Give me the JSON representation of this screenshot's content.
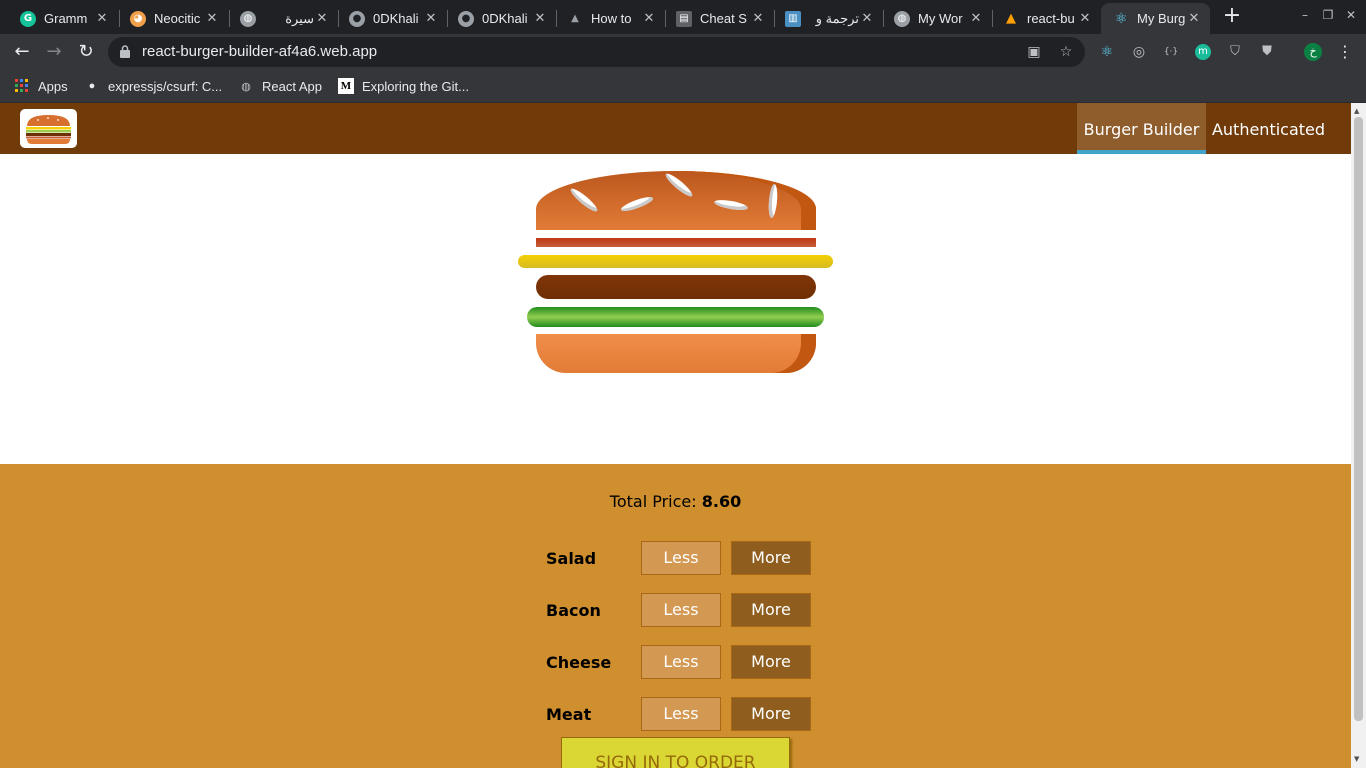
{
  "browser": {
    "tabs": [
      {
        "title": "Gramm",
        "icon": "grammarly-icon",
        "color": "#15c39a",
        "glyph": "G"
      },
      {
        "title": "Neocitic",
        "icon": "neocities-cat-icon",
        "color": "#f0a04b",
        "glyph": "🐱"
      },
      {
        "title": "سيرة",
        "icon": "globe-icon",
        "color": "#9aa0a6",
        "glyph": "◍"
      },
      {
        "title": "0DKhali",
        "icon": "github-icon",
        "color": "#9aa0a6",
        "glyph": "●"
      },
      {
        "title": "0DKhali",
        "icon": "github-icon",
        "color": "#9aa0a6",
        "glyph": "●"
      },
      {
        "title": "How to",
        "icon": "triangle-logo-icon",
        "color": "#9aa0a6",
        "glyph": "▲"
      },
      {
        "title": "Cheat S",
        "icon": "cheatsheet-icon",
        "color": "#5f6368",
        "glyph": "▤"
      },
      {
        "title": "ترجمة و",
        "icon": "book-icon",
        "color": "#4a90c2",
        "glyph": "▥"
      },
      {
        "title": "My Wor",
        "icon": "globe-icon",
        "color": "#9aa0a6",
        "glyph": "◍"
      },
      {
        "title": "react-bu",
        "icon": "firebase-icon",
        "color": "#ffa000",
        "glyph": "▲"
      },
      {
        "title": "My Burg",
        "icon": "react-icon",
        "color": "#61dafb",
        "glyph": "⚛"
      }
    ],
    "active_tab_index": 10,
    "url": "react-burger-builder-af4a6.web.app",
    "bookmarks": [
      {
        "label": "Apps",
        "icon": "apps-grid-icon"
      },
      {
        "label": "expressjs/csurf: C...",
        "icon": "github-icon"
      },
      {
        "label": "React App",
        "icon": "globe-icon"
      },
      {
        "label": "Exploring the Git...",
        "icon": "medium-icon"
      }
    ],
    "profile_initial": "خ"
  },
  "app": {
    "nav": {
      "burger_builder": "Burger Builder",
      "authenticated": "Authenticated"
    },
    "total_price_label": "Total Price:",
    "total_price_value": "8.60",
    "controls": [
      {
        "label": "Salad",
        "less": "Less",
        "more": "More"
      },
      {
        "label": "Bacon",
        "less": "Less",
        "more": "More"
      },
      {
        "label": "Cheese",
        "less": "Less",
        "more": "More"
      },
      {
        "label": "Meat",
        "less": "Less",
        "more": "More"
      }
    ],
    "order_button": "SIGN IN TO ORDER",
    "colors": {
      "header": "#703b09",
      "controls_bg": "#cf8f2e",
      "less_button": "#d39952",
      "more_button": "#8f5e1e",
      "order_button": "#dad735",
      "active_nav_underline": "#40a4c8"
    }
  }
}
